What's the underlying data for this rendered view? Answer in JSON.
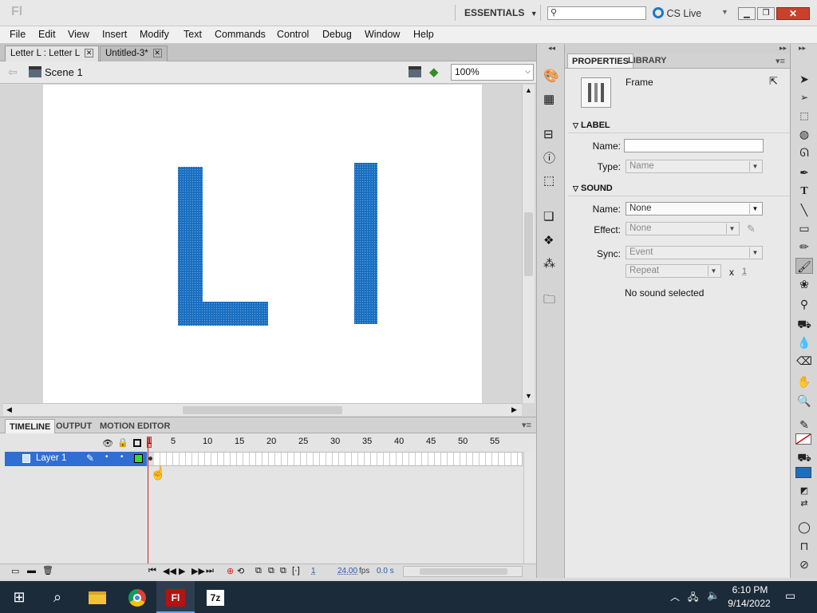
{
  "app": {
    "logo": "Fl",
    "workspace": "ESSENTIALS",
    "cs_live": "CS Live"
  },
  "menu": [
    "File",
    "Edit",
    "View",
    "Insert",
    "Modify",
    "Text",
    "Commands",
    "Control",
    "Debug",
    "Window",
    "Help"
  ],
  "doc_tabs": [
    {
      "label": "Letter L : Letter L"
    },
    {
      "label": "Untitled-3*"
    }
  ],
  "edit_bar": {
    "scene": "Scene 1",
    "zoom": "100%"
  },
  "timeline": {
    "tabs": [
      "TIMELINE",
      "OUTPUT",
      "MOTION EDITOR"
    ],
    "frame_numbers": [
      "1",
      "5",
      "10",
      "15",
      "20",
      "25",
      "30",
      "35",
      "40",
      "45",
      "50",
      "55"
    ],
    "layer_name": "Layer 1",
    "current_frame": "1",
    "fps": "24.00",
    "fps_unit": "fps",
    "time": "0.0 s"
  },
  "properties": {
    "tabs": [
      "PROPERTIES",
      "LIBRARY"
    ],
    "object_type": "Frame",
    "label_section": "LABEL",
    "name_label": "Name:",
    "name_value": "",
    "type_label": "Type:",
    "type_value": "Name",
    "sound_section": "SOUND",
    "sound_name_label": "Name:",
    "sound_name_value": "None",
    "effect_label": "Effect:",
    "effect_value": "None",
    "sync_label": "Sync:",
    "sync_value": "Event",
    "repeat_value": "Repeat",
    "repeat_x": "x",
    "repeat_count": "1",
    "no_sound": "No sound selected"
  },
  "stage_letters": {
    "fill_color": "#1a6fc0"
  },
  "taskbar": {
    "time": "6:10 PM",
    "date": "9/14/2022"
  }
}
